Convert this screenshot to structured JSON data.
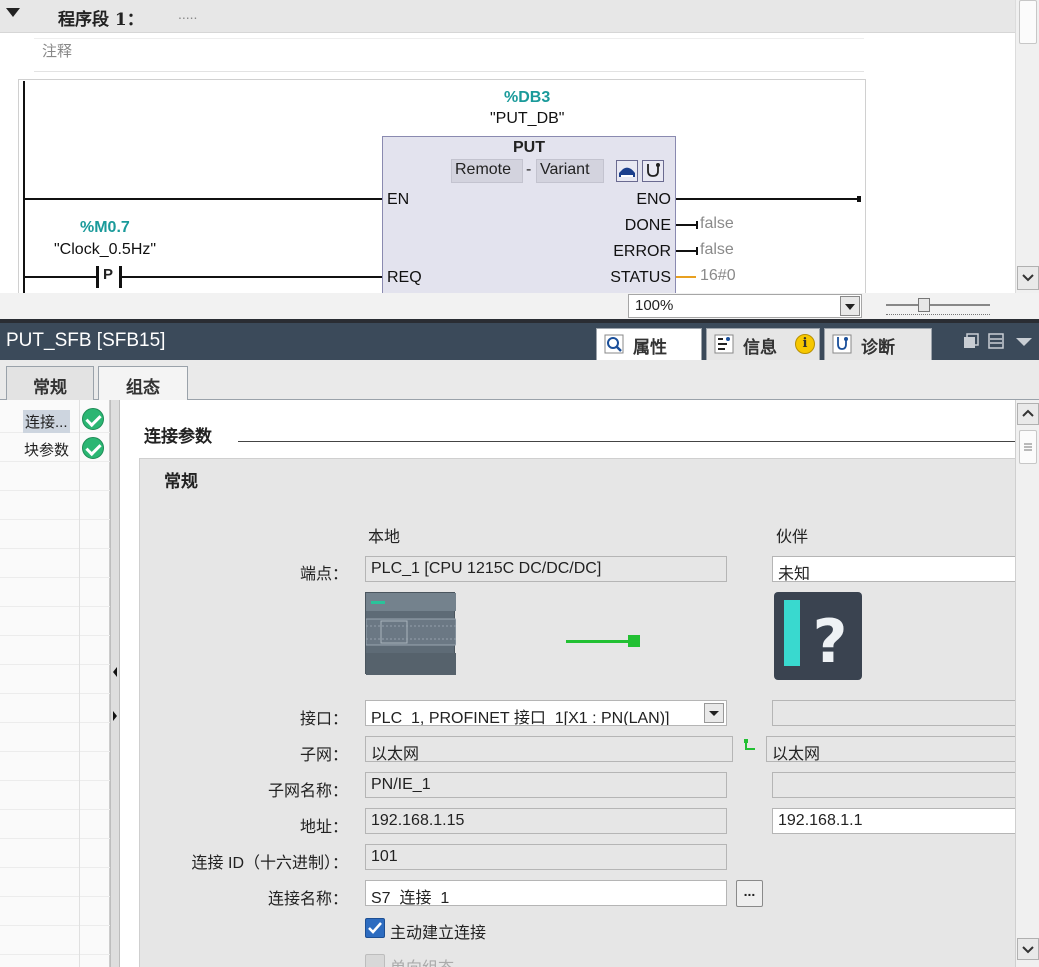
{
  "editor": {
    "network_title": "程序段 1：",
    "network_dots": ".....",
    "comment_placeholder": "注释",
    "instance_db": "%DB3",
    "instance_db_name": "\"PUT_DB\"",
    "block_name": "PUT",
    "type_remote": "Remote",
    "type_sep": "-",
    "type_variant": "Variant",
    "pin_en": "EN",
    "pin_eno": "ENO",
    "pin_done": "DONE",
    "pin_error": "ERROR",
    "pin_status": "STATUS",
    "pin_req": "REQ",
    "done_value": "false",
    "error_value": "false",
    "status_value": "16#0",
    "contact_addr": "%M0.7",
    "contact_name": "\"Clock_0.5Hz\"",
    "contact_type": "P",
    "zoom": "100%"
  },
  "inspector": {
    "title": "PUT_SFB [SFB15]",
    "tabs": [
      {
        "label": "属性",
        "icon": "magnifier-icon"
      },
      {
        "label": "信息",
        "icon": "info-icon"
      },
      {
        "label": "诊断",
        "icon": "stethoscope-icon"
      }
    ],
    "subtabs": [
      "常规",
      "组态"
    ],
    "tree": [
      {
        "label": "连接...",
        "status": "ok"
      },
      {
        "label": "块参数",
        "status": "ok"
      }
    ],
    "section_title": "连接参数",
    "group_title": "常规",
    "col_local": "本地",
    "col_partner": "伙伴",
    "rows": {
      "endpoint_label": "端点：",
      "endpoint_local": "PLC_1 [CPU 1215C DC/DC/DC]",
      "endpoint_partner": "未知",
      "interface_label": "接口：",
      "interface_local": "PLC_1, PROFINET 接口_1[X1 : PN(LAN)]",
      "interface_partner": "",
      "subnet_label": "子网：",
      "subnet_local": "以太网",
      "subnet_partner": "以太网",
      "subnet_name_label": "子网名称：",
      "subnet_name_local": "PN/IE_1",
      "subnet_name_partner": "",
      "address_label": "地址：",
      "address_local": "192.168.1.15",
      "address_partner": "192.168.1.1",
      "conn_id_label": "连接 ID（十六进制）：",
      "conn_id_value": "101",
      "conn_name_label": "连接名称：",
      "conn_name_value": "S7_连接_1",
      "browse_button": "...",
      "active_conn_label": "主动建立连接",
      "active_conn_checked": true,
      "oneway_label": "单向组态"
    }
  },
  "colors": {
    "teal": "#1a9a9a",
    "header_bg": "#3b4a5a",
    "ok_green": "#2bb673",
    "link_green": "#22c033"
  }
}
